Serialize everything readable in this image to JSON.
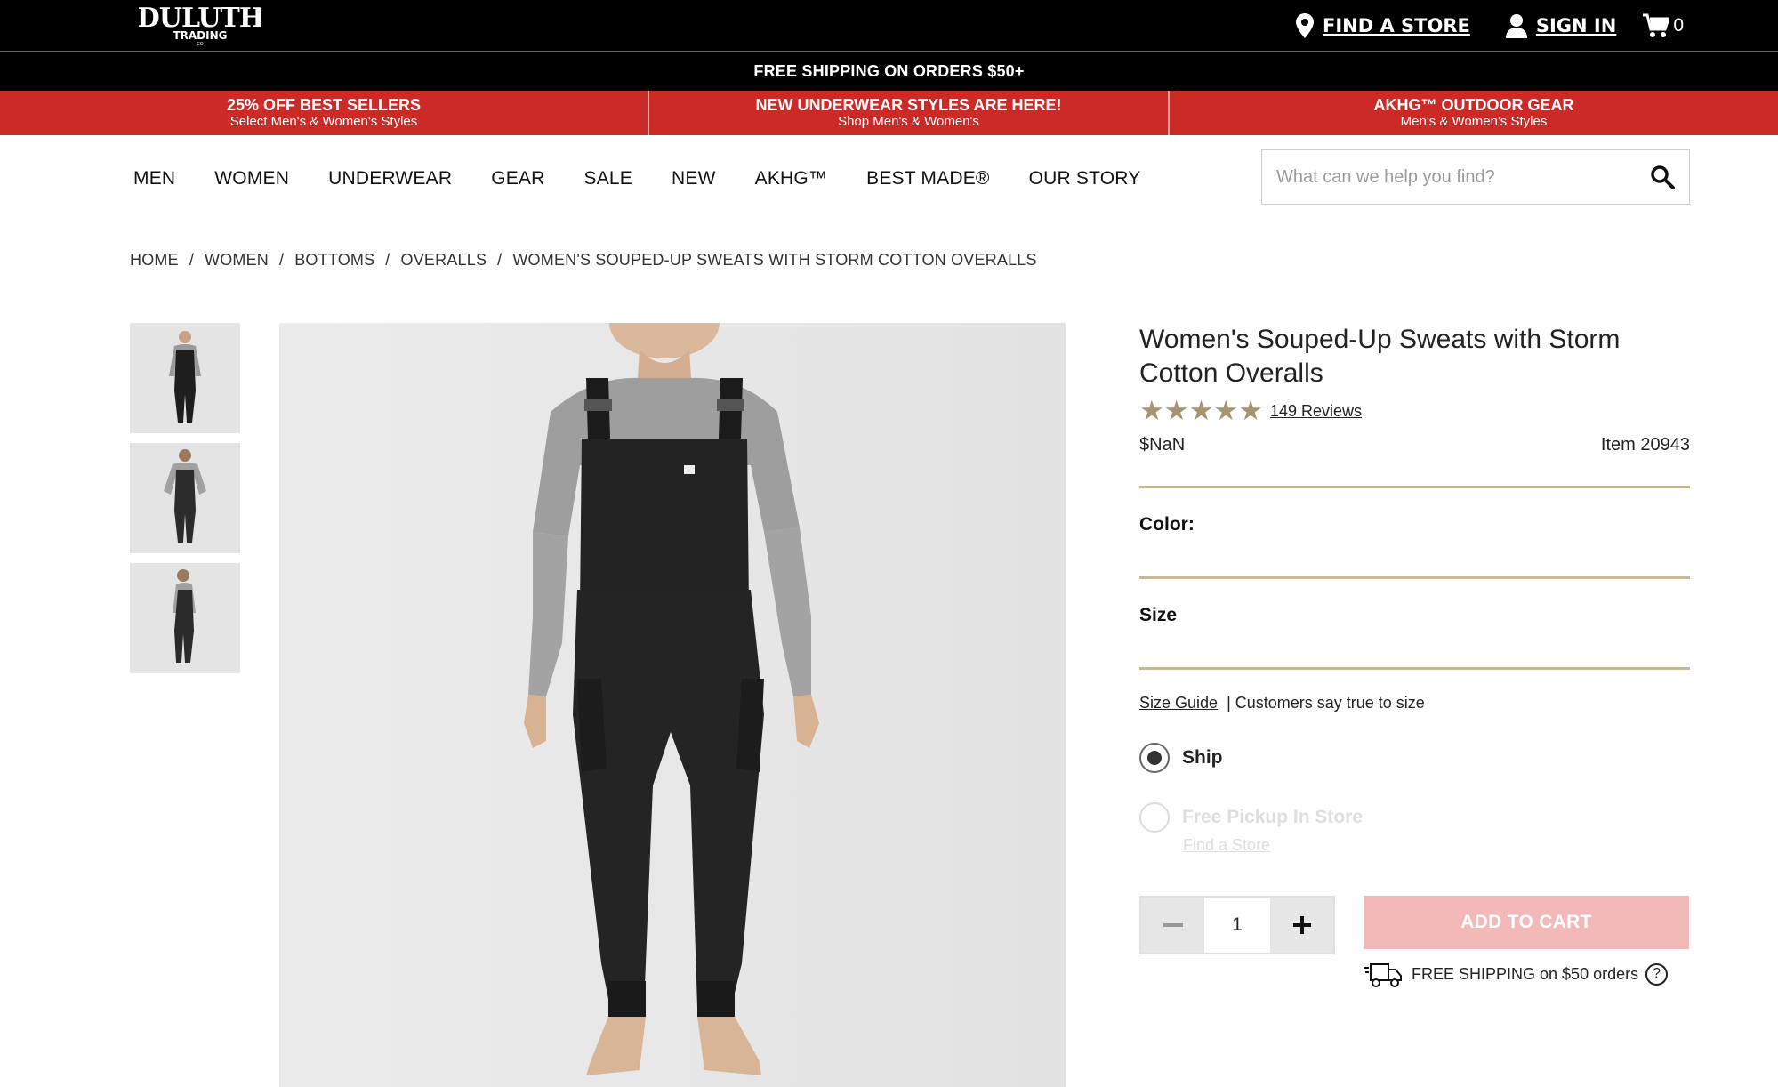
{
  "header": {
    "logo_alt": "DULUTH TRADING CO",
    "find_store": "FIND A STORE",
    "sign_in": "SIGN IN",
    "cart_count": "0"
  },
  "shipping_banner": "FREE SHIPPING ON ORDERS $50+",
  "promos": [
    {
      "title": "25% OFF BEST SELLERS",
      "subtitle": "Select Men's & Women's Styles"
    },
    {
      "title": "NEW UNDERWEAR STYLES ARE HERE!",
      "subtitle": "Shop Men's & Women's"
    },
    {
      "title": "AKHG™ OUTDOOR GEAR",
      "subtitle": "Men's & Women's Styles"
    }
  ],
  "nav": [
    "MEN",
    "WOMEN",
    "UNDERWEAR",
    "GEAR",
    "SALE",
    "NEW",
    "AKHG™",
    "BEST MADE®",
    "OUR STORY"
  ],
  "search": {
    "placeholder": "What can we help you find?"
  },
  "breadcrumb": [
    "HOME",
    "WOMEN",
    "BOTTOMS",
    "OVERALLS",
    "WOMEN'S SOUPED-UP SWEATS WITH STORM COTTON OVERALLS"
  ],
  "product": {
    "title": "Women's Souped-Up Sweats with Storm Cotton Overalls",
    "rating": 5,
    "reviews": "149 Reviews",
    "price": "$NaN",
    "item": "Item 20943",
    "color_label": "Color:",
    "size_label": "Size",
    "size_guide": "Size Guide",
    "size_note": "| Customers say true to size",
    "ship_label": "Ship",
    "pickup_label": "Free Pickup In Store",
    "pickup_link": "Find a Store",
    "quantity": "1",
    "add_to_cart": "ADD TO CART",
    "shipping_note": "FREE SHIPPING on $50 orders",
    "help_symbol": "?"
  },
  "colors": {
    "accent_red": "#cc2a26",
    "star_gold": "#a89470",
    "rule_tan": "#c9b79a",
    "add_to_cart_disabled": "#f2b9b8"
  }
}
